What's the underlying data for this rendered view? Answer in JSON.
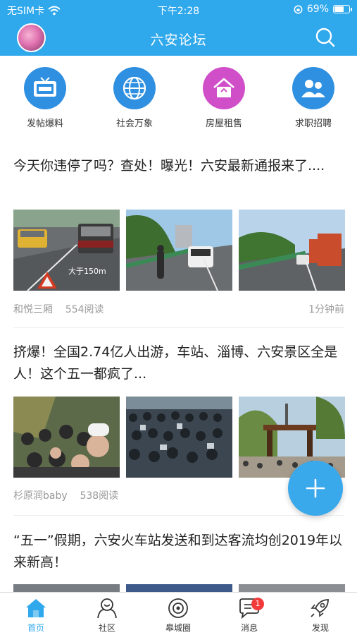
{
  "status_bar": {
    "carrier": "无SIM卡",
    "time": "下午2:28",
    "battery_percent": "69%",
    "battery_level": 0.69
  },
  "header": {
    "title": "六安论坛"
  },
  "quick_links": [
    {
      "label": "发帖爆料",
      "icon": "news-tv-icon",
      "color": "#2f8fe0"
    },
    {
      "label": "社会万象",
      "icon": "globe-icon",
      "color": "#2f8fe0"
    },
    {
      "label": "房屋租售",
      "icon": "house-icon",
      "color": "#d04fc9"
    },
    {
      "label": "求职招聘",
      "icon": "people-icon",
      "color": "#2f8fe0"
    }
  ],
  "posts": [
    {
      "title": "今天你违停了吗？查处！曝光！六安最新通报来了....",
      "author": "和悦三厢",
      "reads": "554阅读",
      "time": "1分钟前",
      "image_text": "大于150m"
    },
    {
      "title": "挤爆！全国2.74亿人出游，车站、淄博、六安景区全是人！这个五一都疯了...",
      "author": "杉原润baby",
      "reads": "538阅读"
    },
    {
      "title": "“五一”假期，六安火车站发送和到达客流均创2019年以来新高！"
    }
  ],
  "tabs": [
    {
      "label": "首页",
      "icon": "home-icon",
      "active": true
    },
    {
      "label": "社区",
      "icon": "community-icon"
    },
    {
      "label": "皋城圈",
      "icon": "circle-icon"
    },
    {
      "label": "消息",
      "icon": "message-icon",
      "badge": "1"
    },
    {
      "label": "发现",
      "icon": "rocket-icon"
    }
  ]
}
